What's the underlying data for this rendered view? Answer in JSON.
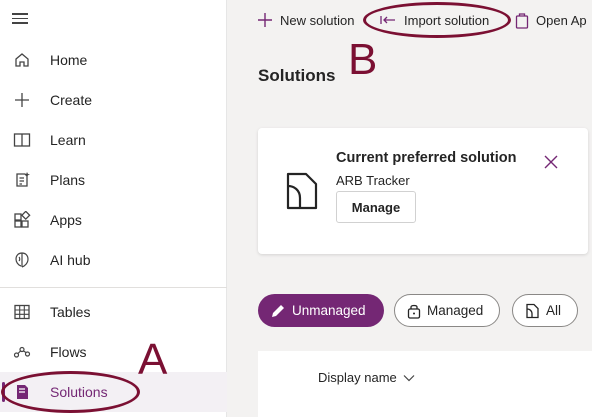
{
  "sidebar": {
    "items": [
      {
        "label": "Home",
        "icon": "home-icon"
      },
      {
        "label": "Create",
        "icon": "plus-icon"
      },
      {
        "label": "Learn",
        "icon": "book-icon"
      },
      {
        "label": "Plans",
        "icon": "plans-icon"
      },
      {
        "label": "Apps",
        "icon": "apps-icon"
      },
      {
        "label": "AI hub",
        "icon": "brain-icon"
      },
      {
        "label": "Tables",
        "icon": "table-icon"
      },
      {
        "label": "Flows",
        "icon": "flow-icon"
      },
      {
        "label": "Solutions",
        "icon": "solution-icon",
        "selected": true
      }
    ]
  },
  "toolbar": {
    "new_solution": "New solution",
    "import_solution": "Import solution",
    "open_app": "Open Ap"
  },
  "page": {
    "title": "Solutions"
  },
  "preferred_card": {
    "title": "Current preferred solution",
    "solution_name": "ARB Tracker",
    "manage_label": "Manage"
  },
  "filters": {
    "unmanaged": "Unmanaged",
    "managed": "Managed",
    "all": "All"
  },
  "table": {
    "column_display_name": "Display name"
  },
  "annotations": {
    "a": "A",
    "b": "B"
  },
  "colors": {
    "accent": "#742774",
    "annotation": "#7b1033"
  }
}
